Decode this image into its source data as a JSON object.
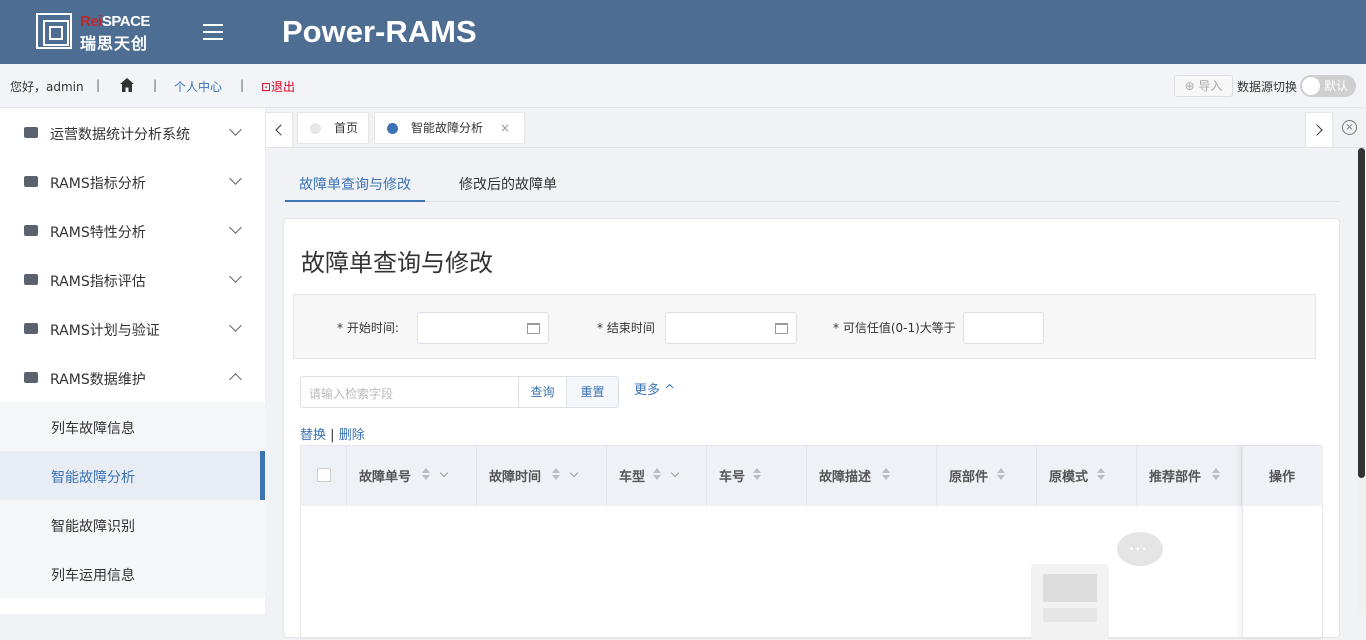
{
  "header": {
    "logo_en_red": "Rei",
    "logo_en": "SPACE",
    "logo_cn": "瑞思天创",
    "app_title": "Power-RAMS"
  },
  "userbar": {
    "greeting": "您好，admin",
    "separator": "|",
    "profile_link": "个人中心",
    "logout_link": "⊡退出",
    "import_label": "⊕ 导入",
    "datasource_label": "数据源切换",
    "toggle_label": "默认"
  },
  "sidebar": {
    "items": [
      {
        "label": "运营数据统计分析系统",
        "icon": "train-icon"
      },
      {
        "label": "RAMS指标分析",
        "icon": "folder-icon"
      },
      {
        "label": "RAMS特性分析",
        "icon": "car-icon"
      },
      {
        "label": "RAMS指标评估",
        "icon": "book-icon"
      },
      {
        "label": "RAMS计划与验证",
        "icon": "user-icon"
      },
      {
        "label": "RAMS数据维护",
        "icon": "card-icon"
      }
    ],
    "subitems": [
      {
        "label": "列车故障信息"
      },
      {
        "label": "智能故障分析"
      },
      {
        "label": "智能故障识别"
      },
      {
        "label": "列车运用信息"
      }
    ]
  },
  "tabs": [
    {
      "label": "首页",
      "dot_color": "#e6e6e6"
    },
    {
      "label": "智能故障分析",
      "dot_color": "#3b73b5",
      "close": "×"
    }
  ],
  "close_all": "×",
  "subtabs": [
    "故障单查询与修改",
    "修改后的故障单"
  ],
  "card": {
    "title": "故障单查询与修改",
    "filters": {
      "start_label": "* 开始时间:",
      "end_label": "* 结束时间",
      "trust_label": "* 可信任值(0-1)大等于"
    },
    "search_placeholder": "请输入检索字段",
    "query_button": "查询",
    "reset_button": "重置",
    "more_label": "更多 ^",
    "replace_link": "替换",
    "action_separator": "|",
    "delete_link": "删除",
    "columns": [
      "故障单号",
      "故障时间",
      "车型",
      "车号",
      "故障描述",
      "原部件",
      "原模式",
      "推荐部件"
    ],
    "op_column": "操作",
    "empty_dots": "•••"
  },
  "colors": {
    "header_bg": "#4d6d92",
    "accent": "#3b73b5",
    "logout": "#d9001b"
  }
}
